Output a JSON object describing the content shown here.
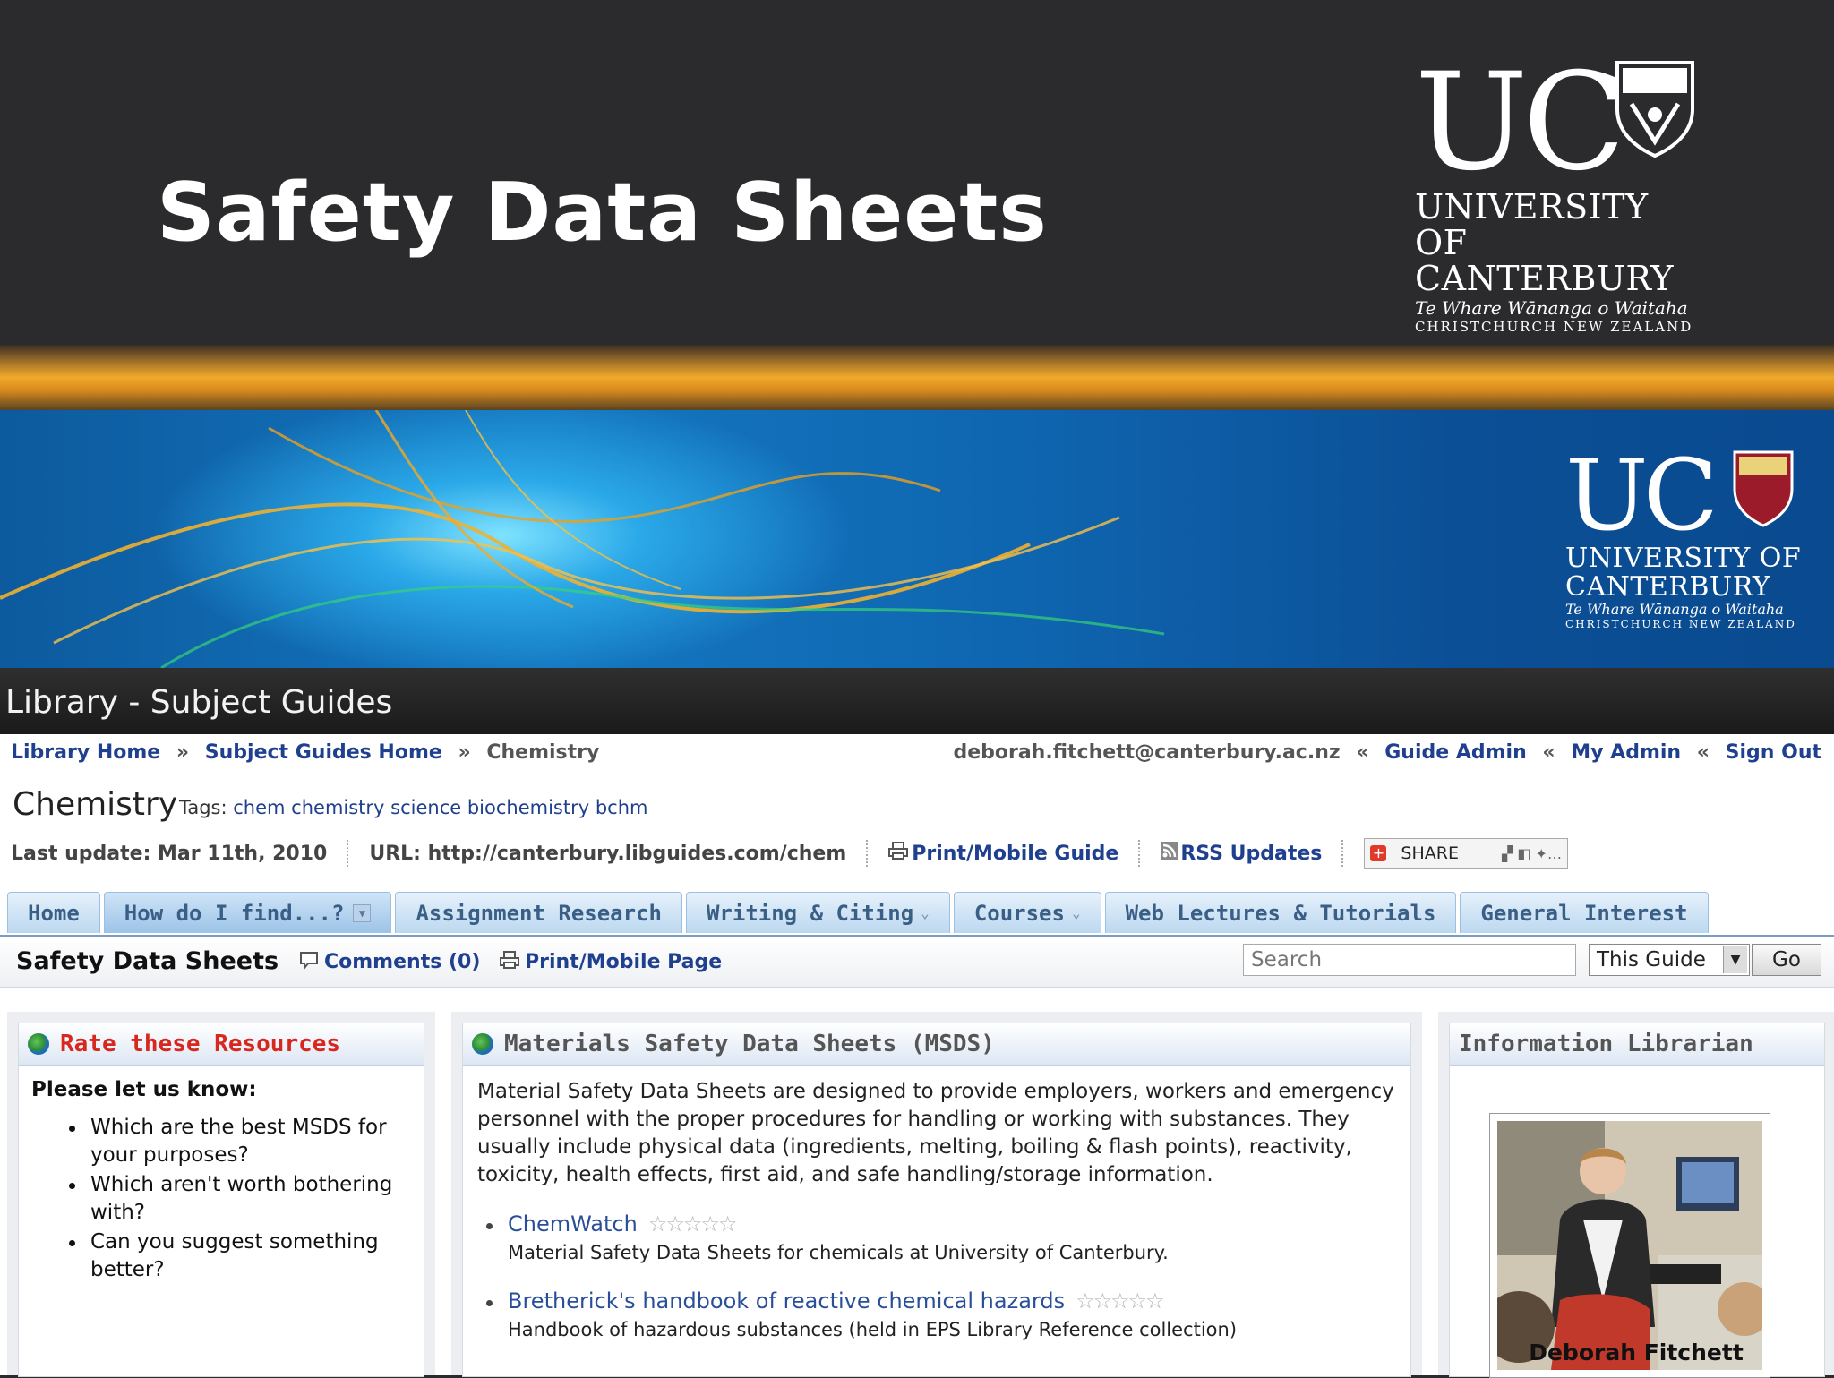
{
  "slide": {
    "title": "Safety Data Sheets",
    "logo": {
      "letters": "UC",
      "line1": "UNIVERSITY OF",
      "line2": "CANTERBURY",
      "line3": "Te Whare Wānanga o Waitaha",
      "line4": "CHRISTCHURCH NEW ZEALAND"
    }
  },
  "site": {
    "header_title": "Library - Subject Guides"
  },
  "breadcrumb": {
    "items": [
      "Library Home",
      "Subject Guides Home"
    ],
    "current": "Chemistry",
    "separator": "»"
  },
  "user_nav": {
    "email": "deborah.fitchett@canterbury.ac.nz",
    "separator": "«",
    "links": [
      "Guide Admin",
      "My Admin",
      "Sign Out"
    ]
  },
  "guide": {
    "title": "Chemistry",
    "tags_label": "Tags:",
    "tags": "chem chemistry science biochemistry bchm",
    "last_update": "Last update: Mar 11th, 2010",
    "url": "URL: http://canterbury.libguides.com/chem",
    "print_label": "Print/Mobile Guide",
    "rss_label": "RSS Updates",
    "share_label": "SHARE"
  },
  "tabs": [
    {
      "label": "Home"
    },
    {
      "label": "How do I find...?"
    },
    {
      "label": "Assignment Research"
    },
    {
      "label": "Writing & Citing"
    },
    {
      "label": "Courses"
    },
    {
      "label": "Web Lectures & Tutorials"
    },
    {
      "label": "General Interest"
    }
  ],
  "page_bar": {
    "title": "Safety Data Sheets",
    "comments": "Comments (0)",
    "print_page": "Print/Mobile Page",
    "search_placeholder": "Search",
    "scope_value": "This Guide",
    "go_label": "Go"
  },
  "left_box": {
    "title": "Rate these Resources",
    "prompt": "Please let us know:",
    "items": [
      "Which are the best MSDS for your purposes?",
      "Which aren't worth bothering with?",
      "Can you suggest something better?"
    ]
  },
  "main_box": {
    "title": "Materials Safety Data Sheets (MSDS)",
    "intro": "Material Safety Data Sheets are designed to provide employers, workers and emergency personnel with the proper procedures for handling or working with substances. They usually include physical data (ingredients, melting, boiling & flash points), reactivity, toxicity, health effects, first aid, and safe handling/storage information.",
    "resources": [
      {
        "name": "ChemWatch",
        "stars": "☆☆☆☆☆",
        "description": "Material Safety Data Sheets for chemicals at University of Canterbury."
      },
      {
        "name": "Bretherick's handbook of reactive chemical hazards",
        "stars": "☆☆☆☆☆",
        "description": "Handbook of hazardous substances (held in EPS Library Reference collection)"
      }
    ]
  },
  "right_box": {
    "title": "Information Librarian",
    "name": "Deborah Fitchett"
  },
  "colors": {
    "slide_bg": "#2b2b2e",
    "link": "#1f3f8f",
    "tab_bg": "#bcd8f0",
    "alert_red": "#d8271e"
  }
}
